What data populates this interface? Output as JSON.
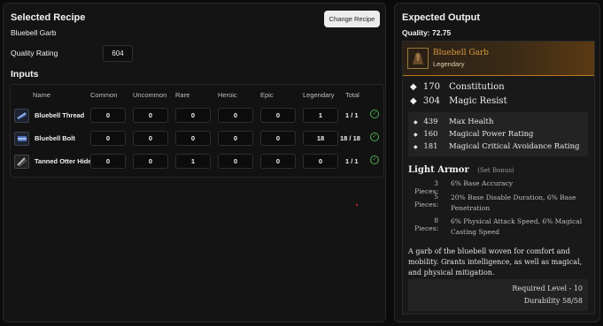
{
  "left": {
    "selected_title": "Selected Recipe",
    "recipe_name": "Bluebell Garb",
    "change_button": "Change Recipe",
    "quality_label": "Quality Rating",
    "quality_value": "604",
    "inputs_title": "Inputs",
    "columns": [
      "Name",
      "Common",
      "Uncommon",
      "Rare",
      "Heroic",
      "Epic",
      "Legendary",
      "Total"
    ],
    "rows": [
      {
        "name": "Bluebell Thread",
        "values": [
          "0",
          "0",
          "0",
          "0",
          "0",
          "1"
        ],
        "total": "1 / 1",
        "icon": "thread-icon"
      },
      {
        "name": "Bluebell Bolt",
        "values": [
          "0",
          "0",
          "0",
          "0",
          "0",
          "18"
        ],
        "total": "18 / 18",
        "icon": "bolt-icon"
      },
      {
        "name": "Tanned Otter Hide",
        "values": [
          "0",
          "0",
          "1",
          "0",
          "0",
          "0"
        ],
        "total": "1 / 1",
        "icon": "hide-icon"
      }
    ]
  },
  "right": {
    "expected_title": "Expected Output",
    "quality_line": "Quality: 72.75",
    "item_name": "Bluebell Garb",
    "rarity": "Legendary",
    "primary_stats": [
      {
        "value": "170",
        "name": "Constitution"
      },
      {
        "value": "304",
        "name": "Magic Resist"
      }
    ],
    "secondary_stats": [
      {
        "value": "439",
        "name": "Max Health"
      },
      {
        "value": "160",
        "name": "Magical Power Rating"
      },
      {
        "value": "181",
        "name": "Magical Critical Avoidance Rating"
      }
    ],
    "set_title": "Light Armor",
    "set_sub": "(Set Bonus)",
    "set_bonuses": [
      {
        "pieces": "3 Pieces:",
        "text": "6% Base Accuracy"
      },
      {
        "pieces": "5 Pieces:",
        "text": "20% Base Disable Duration, 6% Base Penetration"
      },
      {
        "pieces": "8 Pieces:",
        "text": "6% Physical Attack Speed, 6% Magical Casting Speed"
      }
    ],
    "description": "A garb of the bluebell woven for comfort and mobility. Grants intelligence, as well as magical, and physical mitigation.",
    "required_level": "Required Level - 10",
    "durability": "Durability 58/58"
  },
  "colors": {
    "accent_gold": "#d89a40",
    "check_green": "#4caf50"
  }
}
